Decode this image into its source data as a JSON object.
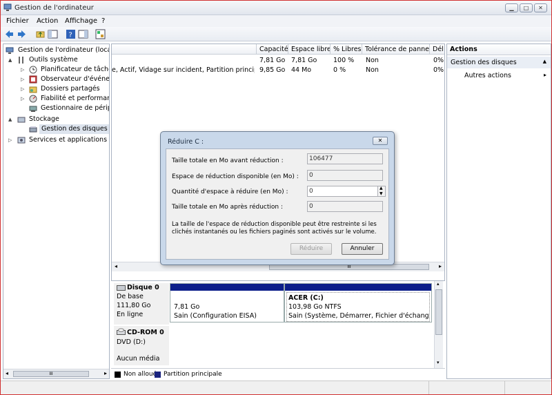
{
  "window": {
    "title": "Gestion de l'ordinateur"
  },
  "menu": [
    "Fichier",
    "Action",
    "Affichage",
    "?"
  ],
  "tree": [
    {
      "label": "Gestion de l'ordinateur (local)",
      "indent": 0,
      "arrow": ""
    },
    {
      "label": "Outils système",
      "indent": 1,
      "arrow": "▲"
    },
    {
      "label": "Planificateur de tâches",
      "indent": 2,
      "arrow": "▷"
    },
    {
      "label": "Observateur d'événeme",
      "indent": 2,
      "arrow": "▷"
    },
    {
      "label": "Dossiers partagés",
      "indent": 2,
      "arrow": "▷"
    },
    {
      "label": "Fiabilité et performance",
      "indent": 2,
      "arrow": "▷"
    },
    {
      "label": "Gestionnaire de périphé",
      "indent": 2,
      "arrow": ""
    },
    {
      "label": "Stockage",
      "indent": 1,
      "arrow": "▲"
    },
    {
      "label": "Gestion des disques",
      "indent": 2,
      "arrow": "",
      "selected": true
    },
    {
      "label": "Services et applications",
      "indent": 1,
      "arrow": "▷"
    }
  ],
  "volume_table": {
    "columns": [
      "Capacité",
      "Espace libre",
      "% Libres",
      "Tolérance de pannes",
      "Dél"
    ],
    "rows": [
      {
        "layout": "",
        "capacity": "7,81 Go",
        "free": "7,81 Go",
        "pct": "100 %",
        "fault": "Non",
        "overhead": "0%"
      },
      {
        "layout": "e, Actif, Vidage sur incident, Partition principale)",
        "capacity": "9,85 Go",
        "free": "44 Mo",
        "pct": "0 %",
        "fault": "Non",
        "overhead": "0%"
      }
    ]
  },
  "actions": {
    "header": "Actions",
    "section": "Gestion des disques",
    "more": "Autres actions"
  },
  "dialog": {
    "title": "Réduire C :",
    "labels": {
      "total_before": "Taille totale en Mo avant réduction :",
      "available": "Espace de réduction disponible (en Mo) :",
      "amount": "Quantité d'espace à réduire (en Mo) :",
      "total_after": "Taille totale en Mo après réduction :"
    },
    "values": {
      "total_before": "106477",
      "available": "0",
      "amount": "0",
      "total_after": "0"
    },
    "note_line1": "La taille de l'espace de réduction disponible peut être restreinte si les",
    "note_line2": "clichés instantanés ou les fichiers paginés sont activés sur le volume.",
    "reduce_label": "Réduire",
    "cancel_label": "Annuler"
  },
  "disk0": {
    "name": "Disque 0",
    "type": "De base",
    "size": "111,80 Go",
    "status": "En ligne",
    "partitions": [
      {
        "name": "",
        "size": "7,81 Go",
        "status": "Sain (Configuration EISA)"
      },
      {
        "name": "ACER  (C:)",
        "size": "103,98 Go NTFS",
        "status": "Sain (Système, Démarrer, Fichier d'échange, Act"
      }
    ]
  },
  "cdrom0": {
    "name": "CD-ROM 0",
    "type": "DVD (D:)",
    "status": "Aucun média"
  },
  "legend": [
    {
      "label": "Non alloué",
      "color": "#000000"
    },
    {
      "label": "Partition principale",
      "color": "#1a237e"
    }
  ],
  "scroll_grip": "III",
  "colors": {
    "partition_bar": "#0d1f8a",
    "selection": "#dde4ee",
    "dialog_frame": "#c9d8ea"
  }
}
